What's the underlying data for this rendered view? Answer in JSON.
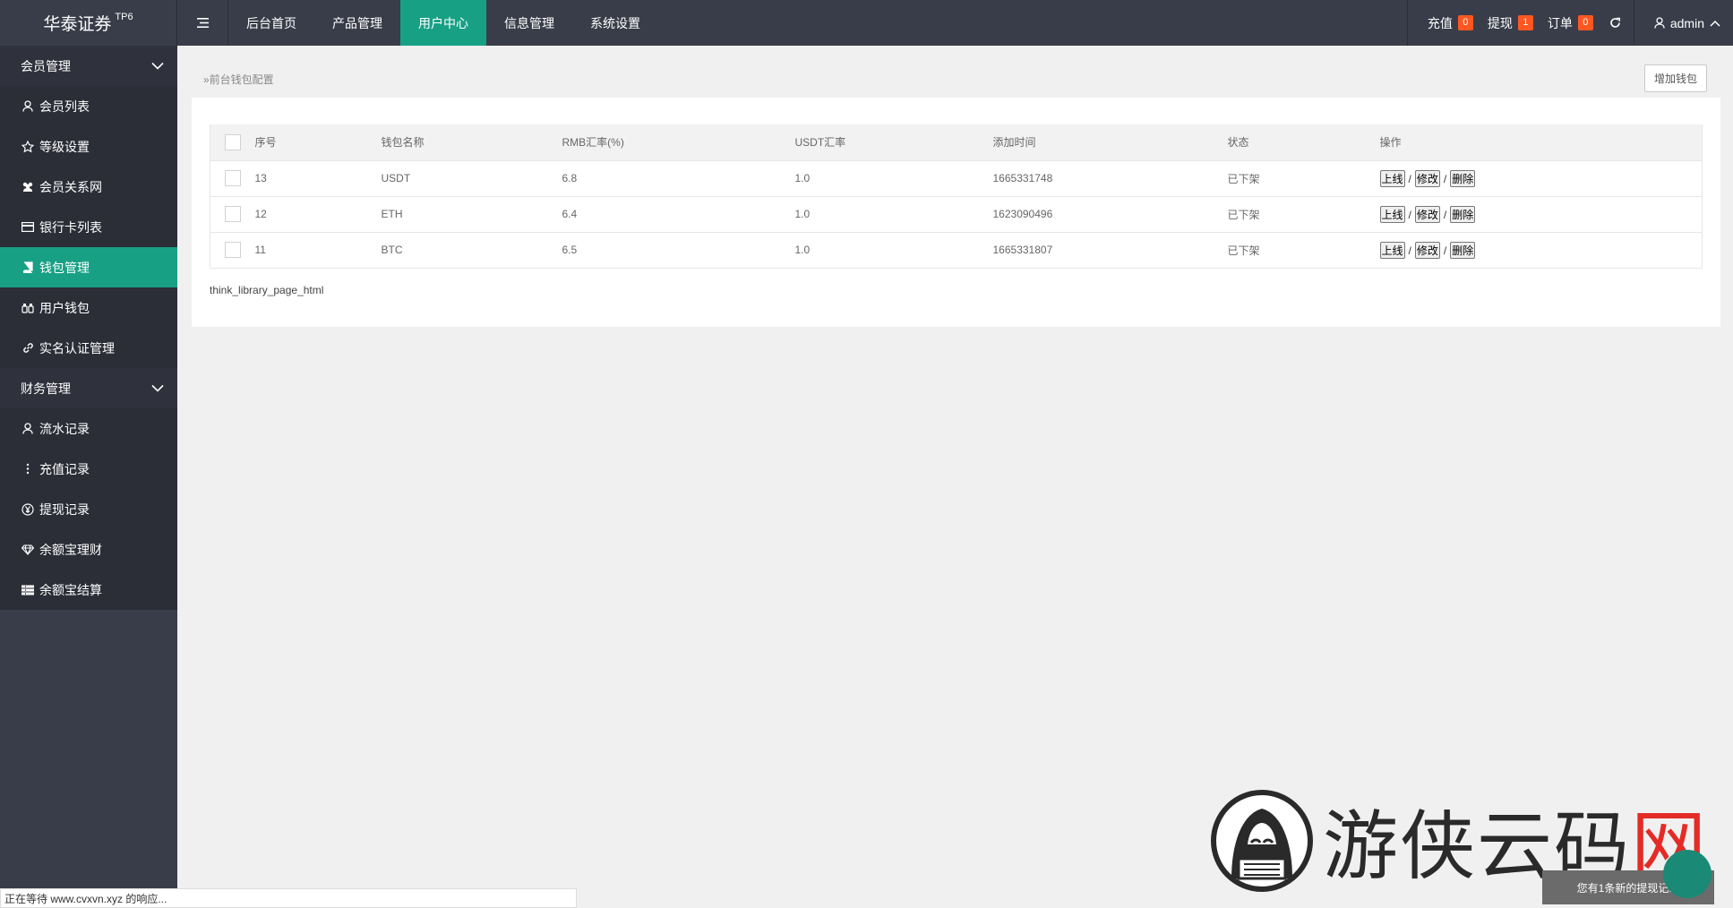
{
  "logo": {
    "text": "华泰证券",
    "sup": "TP6"
  },
  "nav": [
    {
      "label": "后台首页"
    },
    {
      "label": "产品管理"
    },
    {
      "label": "用户中心"
    },
    {
      "label": "信息管理"
    },
    {
      "label": "系统设置"
    }
  ],
  "top_right": {
    "recharge": {
      "label": "充值",
      "count": "0"
    },
    "withdraw": {
      "label": "提现",
      "count": "1"
    },
    "order": {
      "label": "订单",
      "count": "0"
    },
    "user": "admin"
  },
  "sidebar": {
    "member_group": "会员管理",
    "member_items": [
      "会员列表",
      "等级设置",
      "会员关系网",
      "银行卡列表",
      "钱包管理",
      "用户钱包",
      "实名认证管理"
    ],
    "finance_group": "财务管理",
    "finance_items": [
      "流水记录",
      "充值记录",
      "提现记录",
      "余额宝理财",
      "余额宝结算"
    ]
  },
  "breadcrumb": "»前台钱包配置",
  "add_button": "增加钱包",
  "table": {
    "headers": [
      "序号",
      "钱包名称",
      "RMB汇率(%)",
      "USDT汇率",
      "添加时间",
      "状态",
      "操作"
    ],
    "rows": [
      {
        "id": "13",
        "name": "USDT",
        "rmb": "6.8",
        "usdt": "1.0",
        "time": "1665331748",
        "status": "已下架"
      },
      {
        "id": "12",
        "name": "ETH",
        "rmb": "6.4",
        "usdt": "1.0",
        "time": "1623090496",
        "status": "已下架"
      },
      {
        "id": "11",
        "name": "BTC",
        "rmb": "6.5",
        "usdt": "1.0",
        "time": "1665331807",
        "status": "已下架"
      }
    ],
    "ops": {
      "online": "上线",
      "edit": "修改",
      "delete": "删除",
      "sep": "/"
    }
  },
  "pager": "think_library_page_html",
  "watermark": {
    "text_a": "游侠云码",
    "text_b": "网"
  },
  "notice": "您有1条新的提现记录",
  "status_bar": "正在等待 www.cvxvn.xyz 的响应..."
}
